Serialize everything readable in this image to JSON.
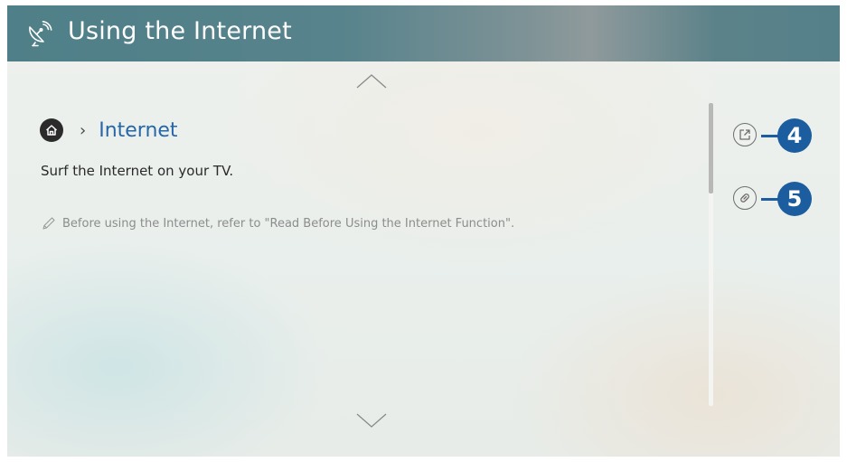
{
  "header": {
    "title": "Using the Internet",
    "icon": "satellite-icon",
    "background_color": "#54808a"
  },
  "navigation": {
    "scroll_up_icon": "chevron-up-icon",
    "scroll_down_icon": "chevron-down-icon"
  },
  "breadcrumb": {
    "home_icon": "home-icon",
    "separator": "›",
    "label": "Internet",
    "label_color": "#2767a8"
  },
  "content": {
    "description": "Surf the Internet on your TV.",
    "note": "Before using the Internet, refer to \"Read Before Using the Internet Function\".",
    "note_icon": "pencil-icon"
  },
  "side_buttons": [
    {
      "icon": "external-link-icon",
      "callout": "4"
    },
    {
      "icon": "link-icon",
      "callout": "5"
    }
  ],
  "callout_color": "#1b5d9e"
}
